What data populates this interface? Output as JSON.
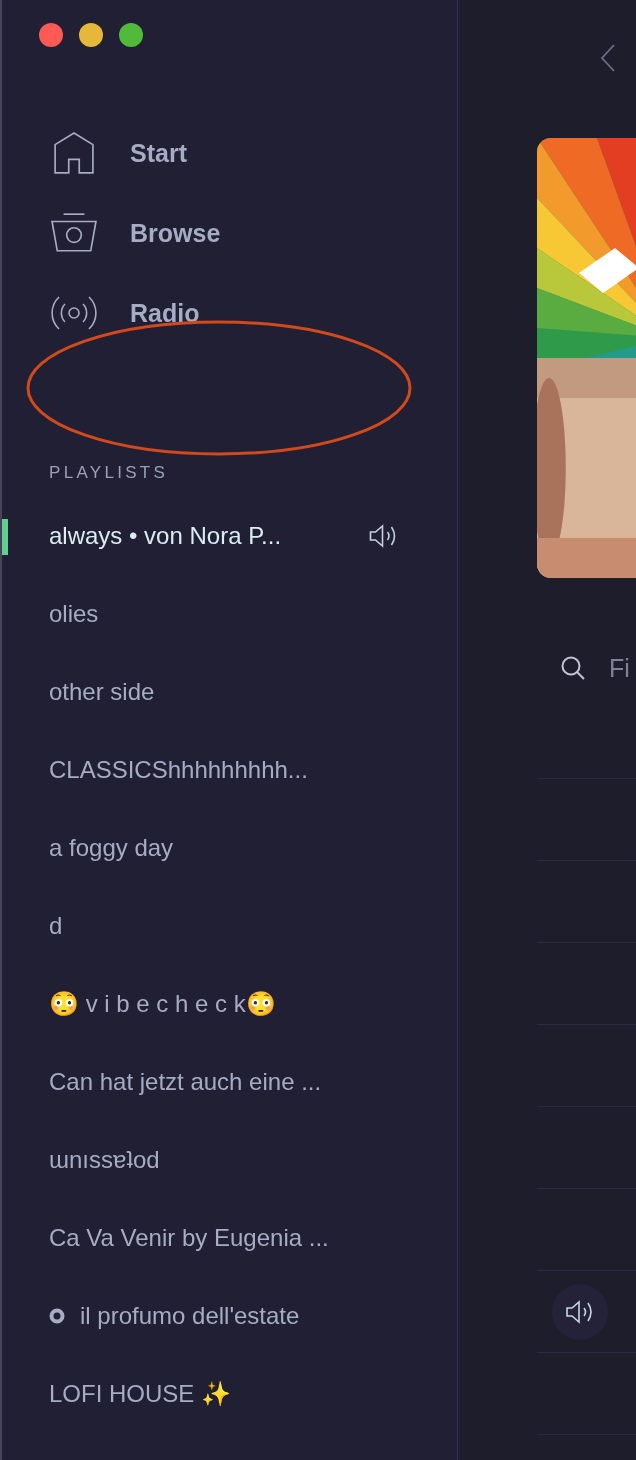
{
  "nav": [
    {
      "label": "Start",
      "kind": "home",
      "selected": false
    },
    {
      "label": "Browse",
      "kind": "browse",
      "selected": false
    },
    {
      "label": "Radio",
      "kind": "radio",
      "selected": false
    }
  ],
  "playlists_heading": "PLAYLISTS",
  "playlists": [
    {
      "name": "always • von Nora P...",
      "kind": "plain",
      "selected": true,
      "playing": true
    },
    {
      "name": "olies",
      "kind": "plain",
      "selected": false,
      "playing": false
    },
    {
      "name": "other side",
      "kind": "plain",
      "selected": false,
      "playing": false
    },
    {
      "name": "CLASSICShhhhhhhhh...",
      "kind": "plain",
      "selected": false,
      "playing": false
    },
    {
      "name": "a foggy day",
      "kind": "plain",
      "selected": false,
      "playing": false
    },
    {
      "name": "d",
      "kind": "plain",
      "selected": false,
      "playing": false
    },
    {
      "name": "😳  v i b e c h e c k😳",
      "kind": "plain",
      "selected": false,
      "playing": false
    },
    {
      "name": "Can hat jetzt auch eine ...",
      "kind": "plain",
      "selected": false,
      "playing": false
    },
    {
      "name": "ɯnıssɐʇod",
      "kind": "plain",
      "selected": false,
      "playing": false
    },
    {
      "name": "Ca Va Venir by Eugenia ...",
      "kind": "plain",
      "selected": false,
      "playing": false
    },
    {
      "name": "il profumo dell'estate",
      "kind": "ring",
      "selected": false,
      "playing": false
    },
    {
      "name": "LOFI HOUSE ✨",
      "kind": "plain",
      "selected": false,
      "playing": false
    }
  ],
  "filter": {
    "placeholder": "Fi"
  },
  "tracks": [
    {
      "playing": false
    },
    {
      "playing": false
    },
    {
      "playing": false
    },
    {
      "playing": false
    },
    {
      "playing": false
    },
    {
      "playing": false
    },
    {
      "playing": true
    },
    {
      "playing": false
    }
  ]
}
